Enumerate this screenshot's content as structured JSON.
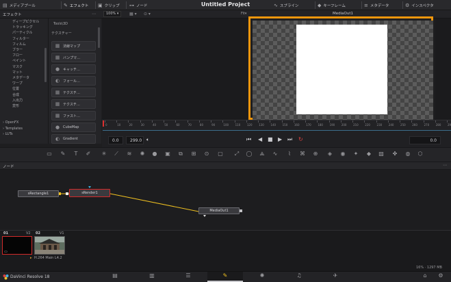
{
  "topbar": {
    "media_pool": "メディアプール",
    "effects": "エフェクト",
    "clips": "クリップ",
    "nodes": "ノード",
    "project_title": "Untitled Project",
    "spline": "スプライン",
    "keyframes": "キーフレーム",
    "metadata": "メタデータ",
    "inspector": "インスペクタ"
  },
  "row2": {
    "zoom_label": "100%",
    "fit_label": "Fit",
    "viewer_name": "MediaOut1"
  },
  "effects_panel": {
    "title": "エフェクト",
    "tree_items": [
      "ディープピクセル",
      "トラッキング",
      "パーティクル",
      "フィルター",
      "フィルム",
      "ブラー",
      "フロー",
      "ペイント",
      "マスク",
      "マット",
      "メタデータ",
      "ワープ",
      "位置",
      "合成",
      "入出力",
      "変形"
    ],
    "categories": [
      "OpenFX",
      "Templates",
      "LUTs"
    ],
    "section_tools": "Tools\\3D",
    "section_texture": "テクスチャー",
    "tools": [
      {
        "icon": "▦",
        "label": "法線マップ"
      },
      {
        "icon": "▦",
        "label": "バンプマ…"
      },
      {
        "icon": "●",
        "label": "キャッチ…"
      },
      {
        "icon": "◐",
        "label": "フォール…"
      },
      {
        "icon": "▦",
        "label": "テクスチ…"
      },
      {
        "icon": "▦",
        "label": "テクスチ…"
      },
      {
        "icon": "▦",
        "label": "ファスト…"
      },
      {
        "icon": "●",
        "label": "CubeMap"
      },
      {
        "icon": "◐",
        "label": "Gradient"
      }
    ]
  },
  "timeline": {
    "ticks": [
      "0",
      "10",
      "20",
      "30",
      "40",
      "50",
      "60",
      "70",
      "80",
      "90",
      "100",
      "110",
      "120",
      "130",
      "140",
      "150",
      "160",
      "170",
      "180",
      "190",
      "200",
      "210",
      "220",
      "230",
      "240",
      "250",
      "260",
      "270",
      "280",
      "290"
    ]
  },
  "transport": {
    "start": "0.0",
    "end": "299.0",
    "current": "0.0"
  },
  "node_editor": {
    "header": "ノード",
    "nodes": [
      {
        "name": "sRectangle1"
      },
      {
        "name": "sRender1"
      },
      {
        "name": "MediaOut1"
      }
    ]
  },
  "clips": [
    {
      "index": "01",
      "track": "V2",
      "codec": ""
    },
    {
      "index": "02",
      "track": "V1",
      "codec": "H.264 Main L4.2"
    }
  ],
  "status": {
    "memory": "16% · 1297 MB"
  },
  "pagebar": {
    "app_name": "DaVinci Resolve 18"
  },
  "colors": {
    "viewer_border": "#f0960c",
    "accent": "#d22a2a",
    "connection_line": "#f0c020"
  }
}
